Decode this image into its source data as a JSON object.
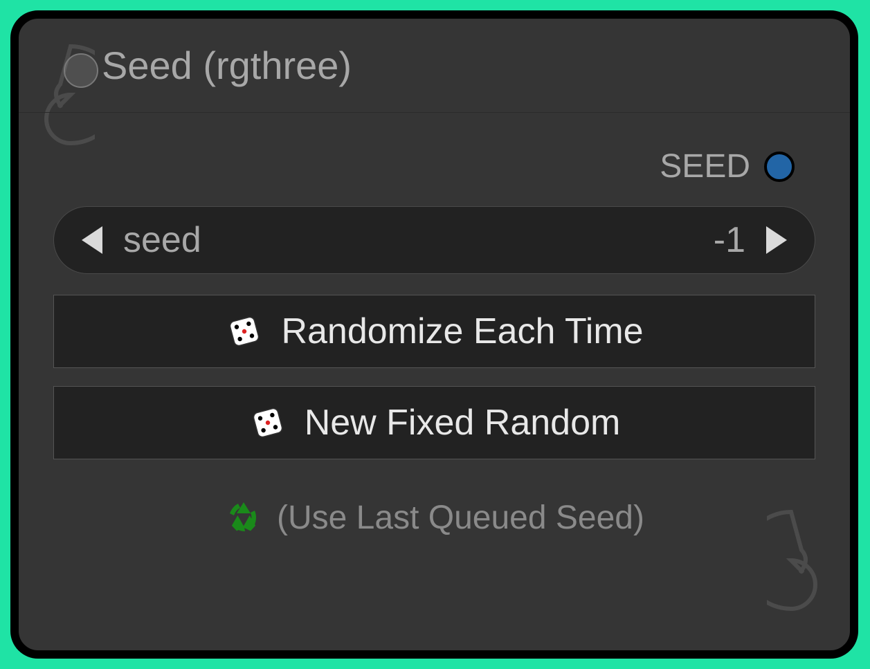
{
  "node": {
    "title": "Seed (rgthree)",
    "output": {
      "label": "SEED",
      "color": "#2265a6"
    },
    "widgets": {
      "seed": {
        "label": "seed",
        "value": "-1"
      },
      "randomize_button": "Randomize Each Time",
      "new_fixed_button": "New Fixed Random",
      "use_last_button": "(Use Last Queued Seed)"
    }
  }
}
